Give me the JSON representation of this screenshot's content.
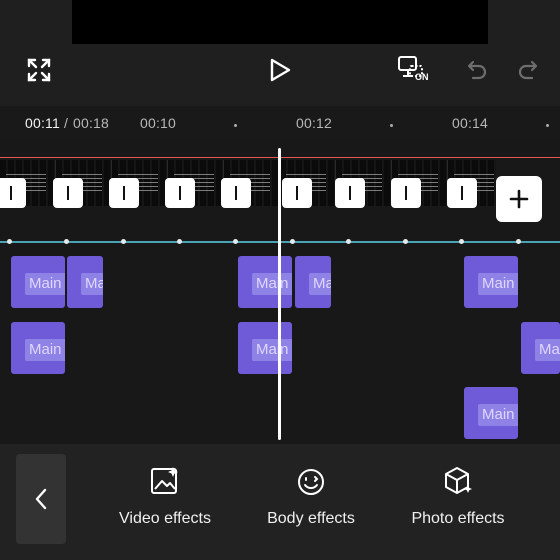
{
  "header": {
    "fullscreen_icon": "fullscreen-icon",
    "play_icon": "play-icon",
    "keyframe_icon": "keyframe-toggle-icon",
    "keyframe_badge": "ON",
    "undo_icon": "undo-icon",
    "redo_icon": "redo-icon"
  },
  "timeline": {
    "current_time": "00:11",
    "separator": "/",
    "total_time": "00:18",
    "ticks": [
      "00:10",
      "00:12",
      "00:14"
    ],
    "add_clip_icon": "plus-icon"
  },
  "effect_clips": [
    {
      "label": "Main"
    },
    {
      "label": "Ma"
    },
    {
      "label": "Main"
    },
    {
      "label": "Ma"
    },
    {
      "label": "Main"
    },
    {
      "label": "Main"
    },
    {
      "label": "Main"
    },
    {
      "label": "Ma"
    },
    {
      "label": "Main"
    }
  ],
  "toolbar": {
    "back_icon": "chevron-left-icon",
    "items": [
      {
        "label": "Video effects",
        "icon": "video-effects-icon"
      },
      {
        "label": "Body effects",
        "icon": "body-effects-icon"
      },
      {
        "label": "Photo effects",
        "icon": "photo-effects-icon"
      }
    ]
  },
  "colors": {
    "accent_clip": "#6f5ad8",
    "clip_label_bg": "#8f82e6",
    "timeline_cyan": "#4aa3b5",
    "timeline_red": "#e35555"
  }
}
